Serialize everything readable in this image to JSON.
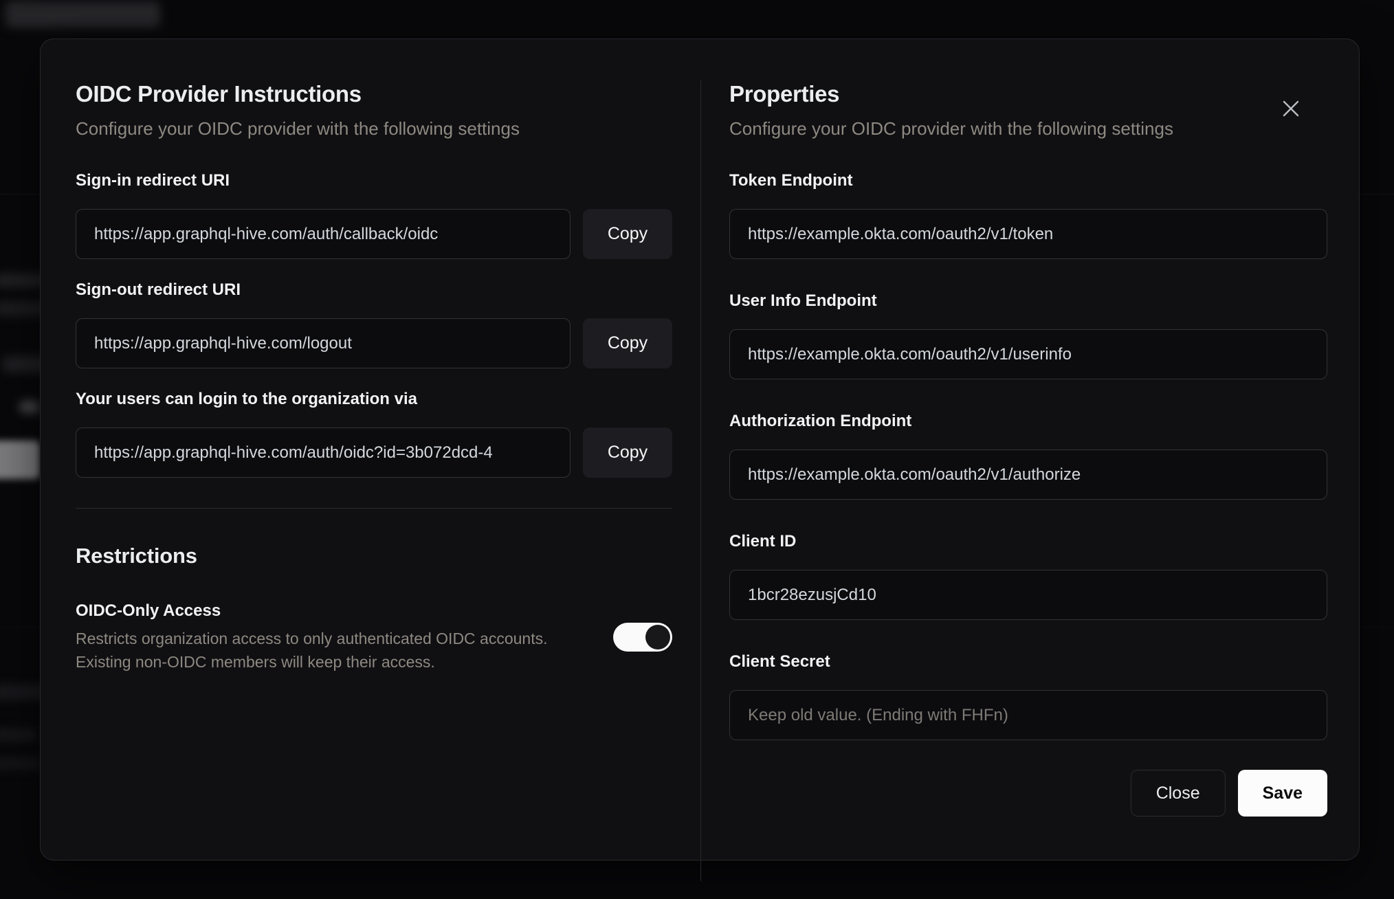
{
  "modal": {
    "left": {
      "title": "OIDC Provider Instructions",
      "subtitle": "Configure your OIDC provider with the following settings",
      "fields": [
        {
          "label": "Sign-in redirect URI",
          "value": "https://app.graphql-hive.com/auth/callback/oidc",
          "copy_label": "Copy"
        },
        {
          "label": "Sign-out redirect URI",
          "value": "https://app.graphql-hive.com/logout",
          "copy_label": "Copy"
        },
        {
          "label": "Your users can login to the organization via",
          "value": "https://app.graphql-hive.com/auth/oidc?id=3b072dcd-4",
          "copy_label": "Copy"
        }
      ],
      "restrictions": {
        "title": "Restrictions",
        "toggle_label": "OIDC-Only Access",
        "toggle_description_line1": "Restricts organization access to only authenticated OIDC accounts.",
        "toggle_description_line2": "Existing non-OIDC members will keep their access.",
        "toggle_on": true
      }
    },
    "right": {
      "title": "Properties",
      "subtitle": "Configure your OIDC provider with the following settings",
      "fields": [
        {
          "label": "Token Endpoint",
          "value": "https://example.okta.com/oauth2/v1/token"
        },
        {
          "label": "User Info Endpoint",
          "value": "https://example.okta.com/oauth2/v1/userinfo"
        },
        {
          "label": "Authorization Endpoint",
          "value": "https://example.okta.com/oauth2/v1/authorize"
        },
        {
          "label": "Client ID",
          "value": "1bcr28ezusjCd10"
        },
        {
          "label": "Client Secret",
          "value": "",
          "placeholder": "Keep old value. (Ending with FHFn)"
        }
      ],
      "buttons": {
        "close": "Close",
        "save": "Save"
      }
    },
    "colors": {
      "modal_background": "#101013",
      "input_border": "#35322f",
      "accent_save": "#fcfcfc",
      "toggle_track_on": "#fafafa",
      "muted_text": "#8e8981"
    }
  }
}
